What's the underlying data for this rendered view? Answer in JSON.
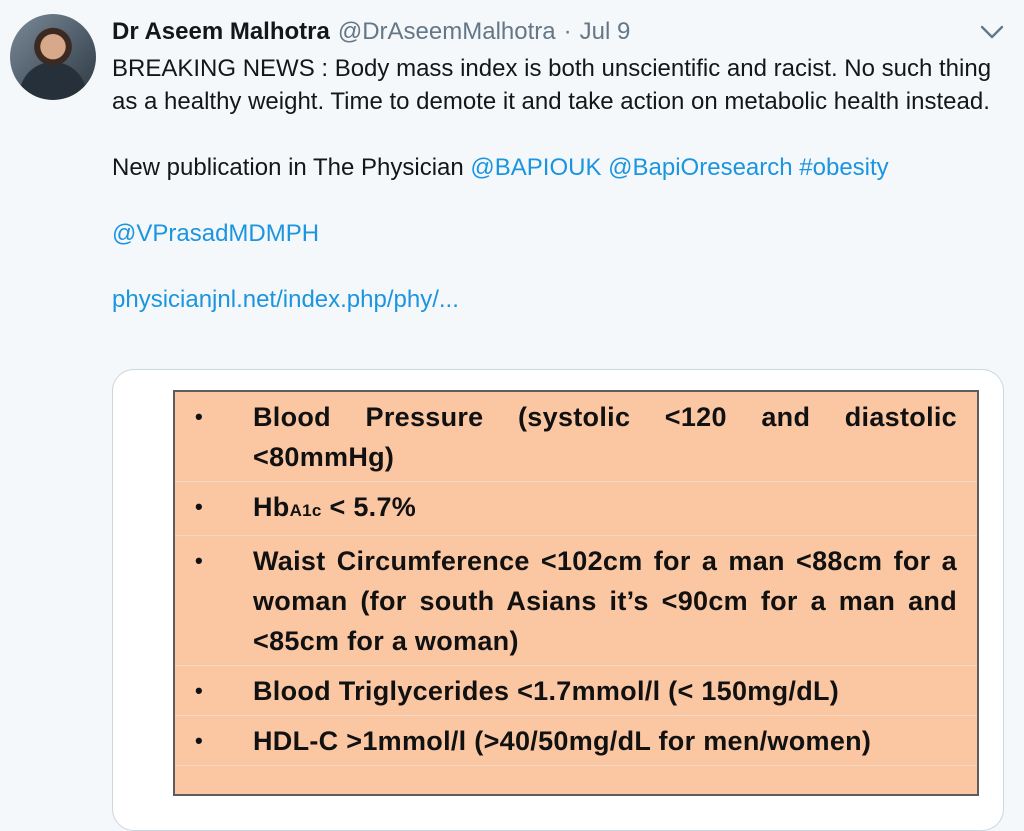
{
  "tweet": {
    "author_name": "Dr Aseem Malhotra",
    "handle": "@DrAseemMalhotra",
    "separator": "·",
    "date": "Jul 9",
    "text_line1": "BREAKING NEWS : Body mass index is both unscientific and racist. No such thing as a healthy weight. Time to demote it and take action on metabolic health instead.",
    "text_line2_prefix": "New publication in The Physician ",
    "mention1": "@BAPIOUK",
    "mention2": "@BapiOresearch",
    "hashtag": "#obesity",
    "mention3": "@VPrasadMDMPH",
    "url": "physicianjnl.net/index.php/phy/..."
  },
  "card": {
    "bullet": "•",
    "rows": [
      {
        "text": "Blood Pressure (systolic <120 and diastolic <80mmHg)"
      },
      {
        "prefix": "Hb",
        "sub": "A1c",
        "suffix": " < 5.7%"
      },
      {
        "text": "Waist Circumference <102cm for a man <88cm for a woman (for south Asians it’s <90cm for a man and <85cm for a woman)"
      },
      {
        "text": "Blood Triglycerides <1.7mmol/l (< 150mg/dL)"
      },
      {
        "text": "HDL-C >1mmol/l (>40/50mg/dL for men/women)"
      }
    ]
  },
  "icons": {
    "caret": "chevron-down-icon",
    "avatar": "profile-photo"
  },
  "colors": {
    "link": "#1b95e0",
    "meta": "#657786",
    "card_fill": "#fbc7a3"
  }
}
